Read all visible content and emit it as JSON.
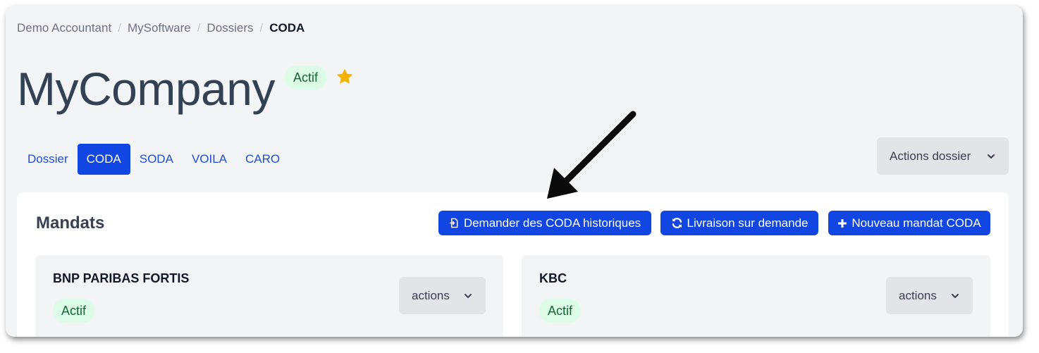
{
  "breadcrumb": {
    "items": [
      "Demo Accountant",
      "MySoftware",
      "Dossiers"
    ],
    "current": "CODA",
    "separator": "/"
  },
  "company": {
    "name": "MyCompany",
    "status": "Actif",
    "favorite": true
  },
  "tabs": {
    "items": [
      {
        "label": "Dossier",
        "active": false
      },
      {
        "label": "CODA",
        "active": true
      },
      {
        "label": "SODA",
        "active": false
      },
      {
        "label": "VOILA",
        "active": false
      },
      {
        "label": "CARO",
        "active": false
      }
    ]
  },
  "dossier_actions": {
    "label": "Actions dossier",
    "icon": "chevron-down-icon"
  },
  "mandats": {
    "title": "Mandats",
    "buttons": {
      "historical": {
        "label": "Demander des CODA historiques",
        "icon": "document-icon"
      },
      "on_demand": {
        "label": "Livraison sur demande",
        "icon": "refresh-icon"
      },
      "new_mandate": {
        "label": "Nouveau mandat CODA",
        "icon": "plus-icon"
      }
    },
    "cards": [
      {
        "bank": "BNP PARIBAS FORTIS",
        "status": "Actif",
        "actions_label": "actions"
      },
      {
        "bank": "KBC",
        "status": "Actif",
        "actions_label": "actions"
      }
    ]
  },
  "colors": {
    "primary": "#1146e3",
    "active_badge_bg": "#dcfce7",
    "active_badge_text": "#166534",
    "star": "#f5b301",
    "background": "#f3f4f6"
  }
}
